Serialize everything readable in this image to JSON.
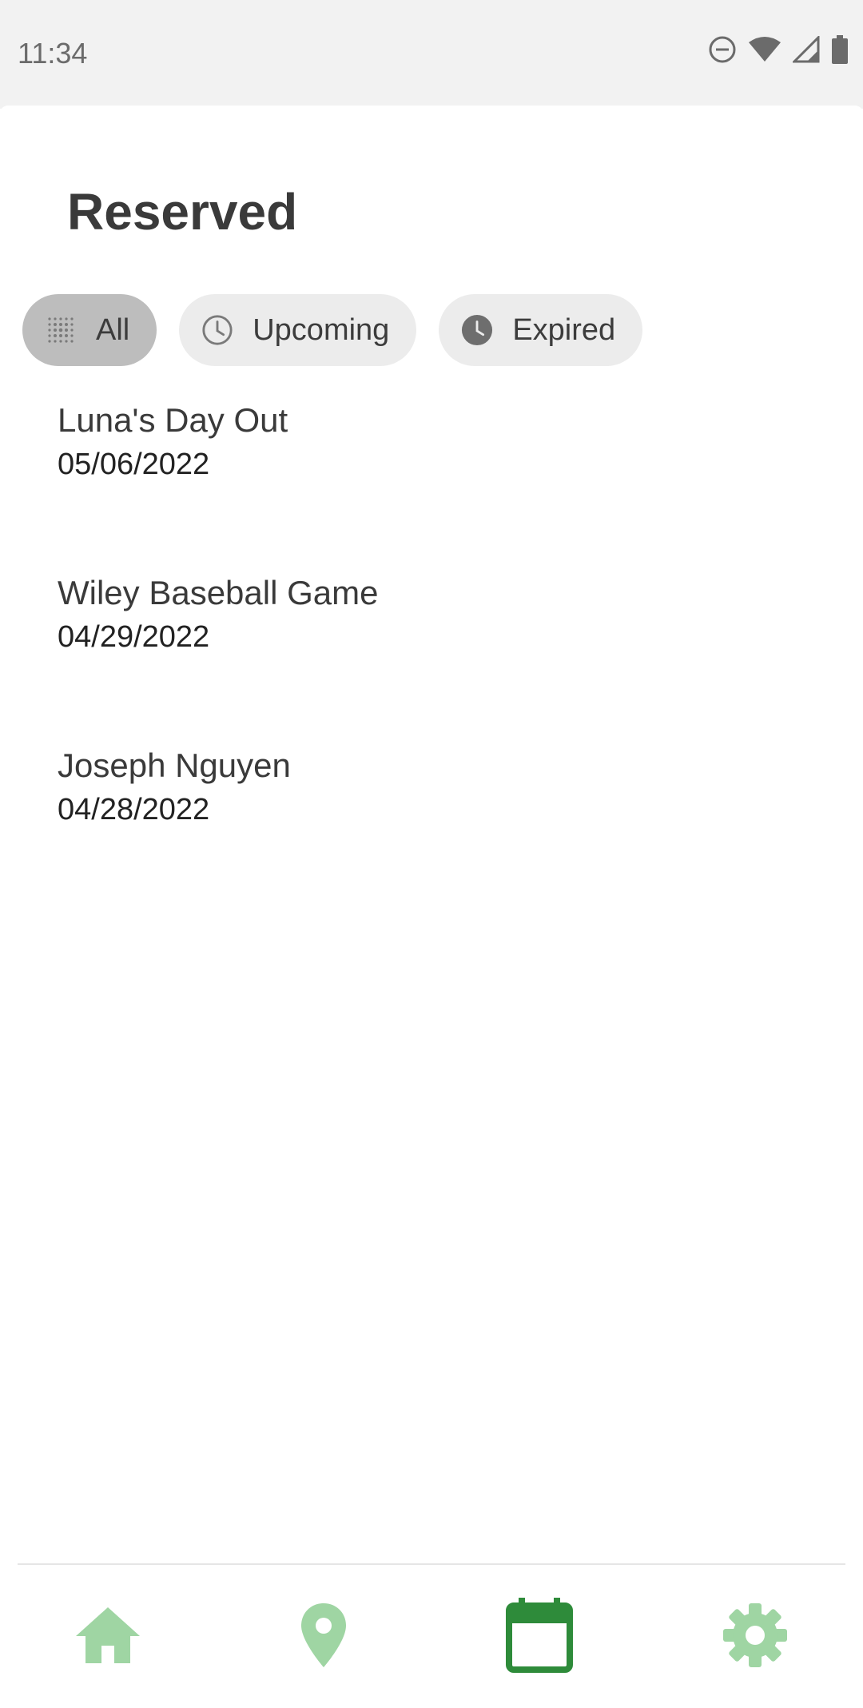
{
  "status_bar": {
    "time": "11:34",
    "icons": [
      "do-not-disturb-icon",
      "wifi-icon",
      "signal-icon",
      "battery-icon"
    ]
  },
  "page": {
    "title": "Reserved"
  },
  "filters": [
    {
      "label": "All",
      "icon": "grid-dots-icon",
      "selected": true
    },
    {
      "label": "Upcoming",
      "icon": "clock-outline-icon",
      "selected": false
    },
    {
      "label": "Expired",
      "icon": "clock-filled-icon",
      "selected": false
    }
  ],
  "reservations": [
    {
      "title": "Luna's Day Out",
      "date": "05/06/2022"
    },
    {
      "title": "Wiley Baseball Game",
      "date": "04/29/2022"
    },
    {
      "title": "Joseph Nguyen",
      "date": "04/28/2022"
    }
  ],
  "bottom_nav": {
    "items": [
      {
        "icon": "home-icon",
        "active": false
      },
      {
        "icon": "location-pin-icon",
        "active": false
      },
      {
        "icon": "calendar-icon",
        "active": true
      },
      {
        "icon": "settings-gear-icon",
        "active": false
      }
    ],
    "colors": {
      "active": "#2e8b3a",
      "inactive": "#9fd5a3"
    }
  }
}
